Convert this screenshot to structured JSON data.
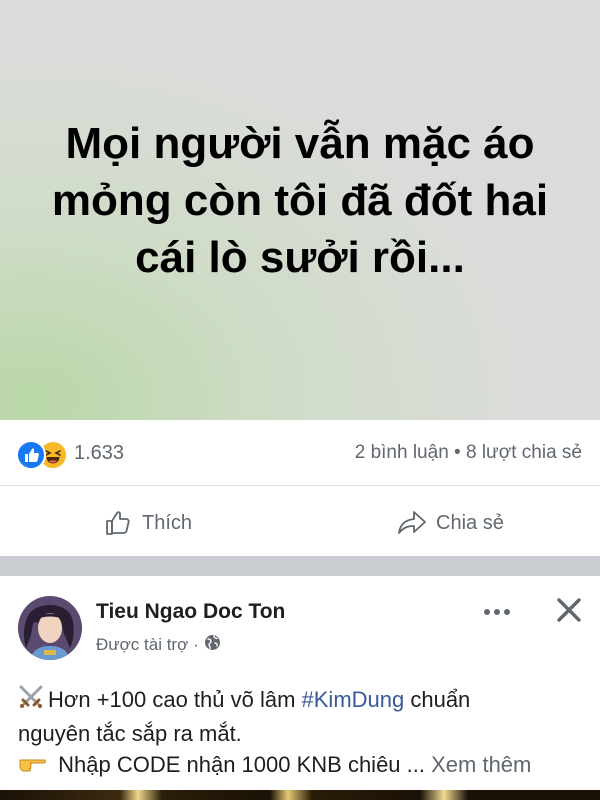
{
  "status_post": {
    "text": "Mọi người vẫn mặc áo mỏng còn tôi đã đốt hai cái lò sưởi rồi...",
    "background_colors": [
      "#b9d7a8",
      "#dcdcdc"
    ]
  },
  "reactions": {
    "icons": [
      "like-icon",
      "haha-icon"
    ],
    "count": "1.633",
    "comments": "2 bình luận",
    "separator": "•",
    "shares": "8 lượt chia sẻ"
  },
  "actions": {
    "like_label": "Thích",
    "share_label": "Chia sẻ"
  },
  "sponsored_post": {
    "page_name": "Tieu Ngao Doc Ton",
    "sponsored_label": "Được tài trợ",
    "dot": "·",
    "privacy_icon": "globe-icon",
    "body": {
      "line1_text": "Hơn +100 cao thủ võ lâm ",
      "hashtag": "#KimDung",
      "line1_tail": " chuẩn",
      "line2": "nguyên tắc sắp ra mắt.",
      "line3_text": " Nhập CODE nhận 1000 KNB chiêu ... ",
      "see_more": "Xem thêm"
    }
  },
  "colors": {
    "facebook_blue": "#1877f2",
    "haha_yellow": "#f7b928",
    "secondary_text": "#606770",
    "hashtag": "#385898",
    "separator_gray": "#c9ccd1"
  }
}
